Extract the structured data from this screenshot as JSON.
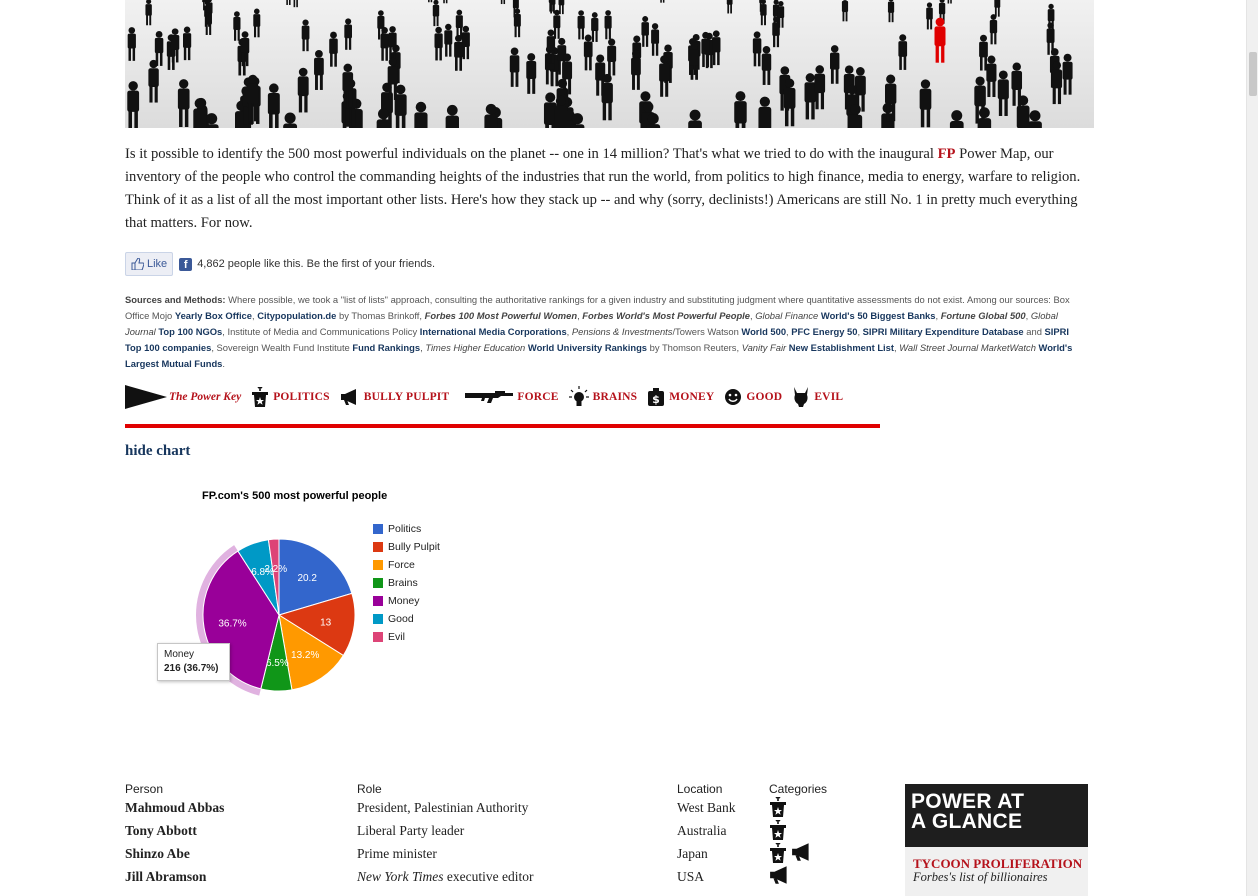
{
  "intro": {
    "text_before": "Is it possible to identify the 500 most powerful individuals on the planet -- one in 14 million? That's what we tried to do with the inaugural ",
    "fp": "FP",
    "text_after": " Power Map, our inventory of the people who control the commanding heights of the industries that run the world, from politics to high finance, media to energy, warfare to religion. Think of it as a list of all the most important other lists. Here's how they stack up -- and why (sorry, declinists!) Americans are still No. 1 in pretty much everything that matters. For now."
  },
  "social": {
    "like_label": "Like",
    "fb_letter": "f",
    "count_text": "4,862 people like this. Be the first of your friends."
  },
  "sources": {
    "label": "Sources and Methods:",
    "t1": " Where possible, we took a \"list of lists\" approach, consulting the authoritative rankings for a given industry and substituting judgment where quantitative assessments do not exist. Among our sources: Box Office Mojo ",
    "l1": "Yearly Box Office",
    "t2": ", ",
    "l2": "Citypopulation.de",
    "t3": " by Thomas Brinkoff, ",
    "l3": "Forbes 100 Most Powerful Women",
    "t4": ", ",
    "l4": "Forbes World's Most Powerful People",
    "t5": ", ",
    "i5": "Global Finance",
    "l5": " World's 50 Biggest Banks",
    "t6": ", ",
    "l6": "Fortune Global 500",
    "t7": ", ",
    "i7": "Global Journal",
    "l7": " Top 100 NGOs",
    "t8": ", Institute of Media and Communications Policy ",
    "l8": "International Media Corporations",
    "t9": ", ",
    "i9": "Pensions & Investments",
    "t9b": "/Towers Watson ",
    "l9": "World 500",
    "t10": ", ",
    "l10": "PFC Energy 50",
    "t11": ", ",
    "l11": "SIPRI Military Expenditure Database",
    "t12": " and ",
    "l12": "SIPRI Top 100 companies",
    "t13": ", Sovereign Wealth Fund Institute ",
    "l13": "Fund Rankings",
    "t14": ", ",
    "i14": "Times Higher Education",
    "l14": " World University Rankings",
    "t15": " by Thomson Reuters, ",
    "i15": "Vanity Fair",
    "l15": " New Establishment List",
    "t16": ", ",
    "i16": "Wall Street Journal MarketWatch",
    "l16": " World's Largest Mutual Funds",
    "t17": "."
  },
  "power_key": {
    "title": "The Power Key",
    "items": [
      {
        "label": "POLITICS",
        "icon": "podium-icon"
      },
      {
        "label": "BULLY PULPIT",
        "icon": "megaphone-icon"
      },
      {
        "label": "FORCE",
        "icon": "rifle-icon"
      },
      {
        "label": "BRAINS",
        "icon": "lightbulb-icon"
      },
      {
        "label": "MONEY",
        "icon": "money-bag-icon"
      },
      {
        "label": "GOOD",
        "icon": "smiley-icon"
      },
      {
        "label": "EVIL",
        "icon": "devil-icon"
      }
    ]
  },
  "hide_chart": "hide chart",
  "chart_data": {
    "type": "pie",
    "title": "FP.com's 500 most powerful people",
    "categories": [
      "Politics",
      "Bully Pulpit",
      "Force",
      "Brains",
      "Money",
      "Good",
      "Evil"
    ],
    "values": [
      20.2,
      13.4,
      13.2,
      6.5,
      36.7,
      6.8,
      2.2
    ],
    "slice_labels": [
      "20.2",
      "13",
      "13.2%",
      "6.5%",
      "36.7%",
      "6.8%",
      "2.2%"
    ],
    "colors": [
      "#3366cc",
      "#dc3912",
      "#ff9900",
      "#109618",
      "#990099",
      "#0099c6",
      "#dd4477"
    ],
    "highlighted": "Money",
    "legend_position": "right",
    "tooltip": {
      "label": "Money",
      "value": "216 (36.7%)"
    }
  },
  "table": {
    "headers": [
      "Person",
      "Role",
      "Location",
      "Categories"
    ],
    "rows": [
      {
        "name": "Mahmoud Abbas",
        "role_italic": "",
        "role": "President, Palestinian Authority",
        "location": "West Bank",
        "categories": [
          "podium-icon"
        ]
      },
      {
        "name": "Tony Abbott",
        "role_italic": "",
        "role": "Liberal Party leader",
        "location": "Australia",
        "categories": [
          "podium-icon"
        ]
      },
      {
        "name": "Shinzo Abe",
        "role_italic": "",
        "role": "Prime minister",
        "location": "Japan",
        "categories": [
          "podium-icon",
          "megaphone-icon"
        ]
      },
      {
        "name": "Jill Abramson",
        "role_italic": "New York Times",
        "role": " executive editor",
        "location": "USA",
        "categories": [
          "megaphone-icon"
        ]
      }
    ]
  },
  "promo": {
    "line1": "POWER AT",
    "line2": "A GLANCE",
    "sub": "TYCOON PROLIFERATION",
    "sub2_italic": "Forbes",
    "sub2": "'s list of billionaires"
  }
}
